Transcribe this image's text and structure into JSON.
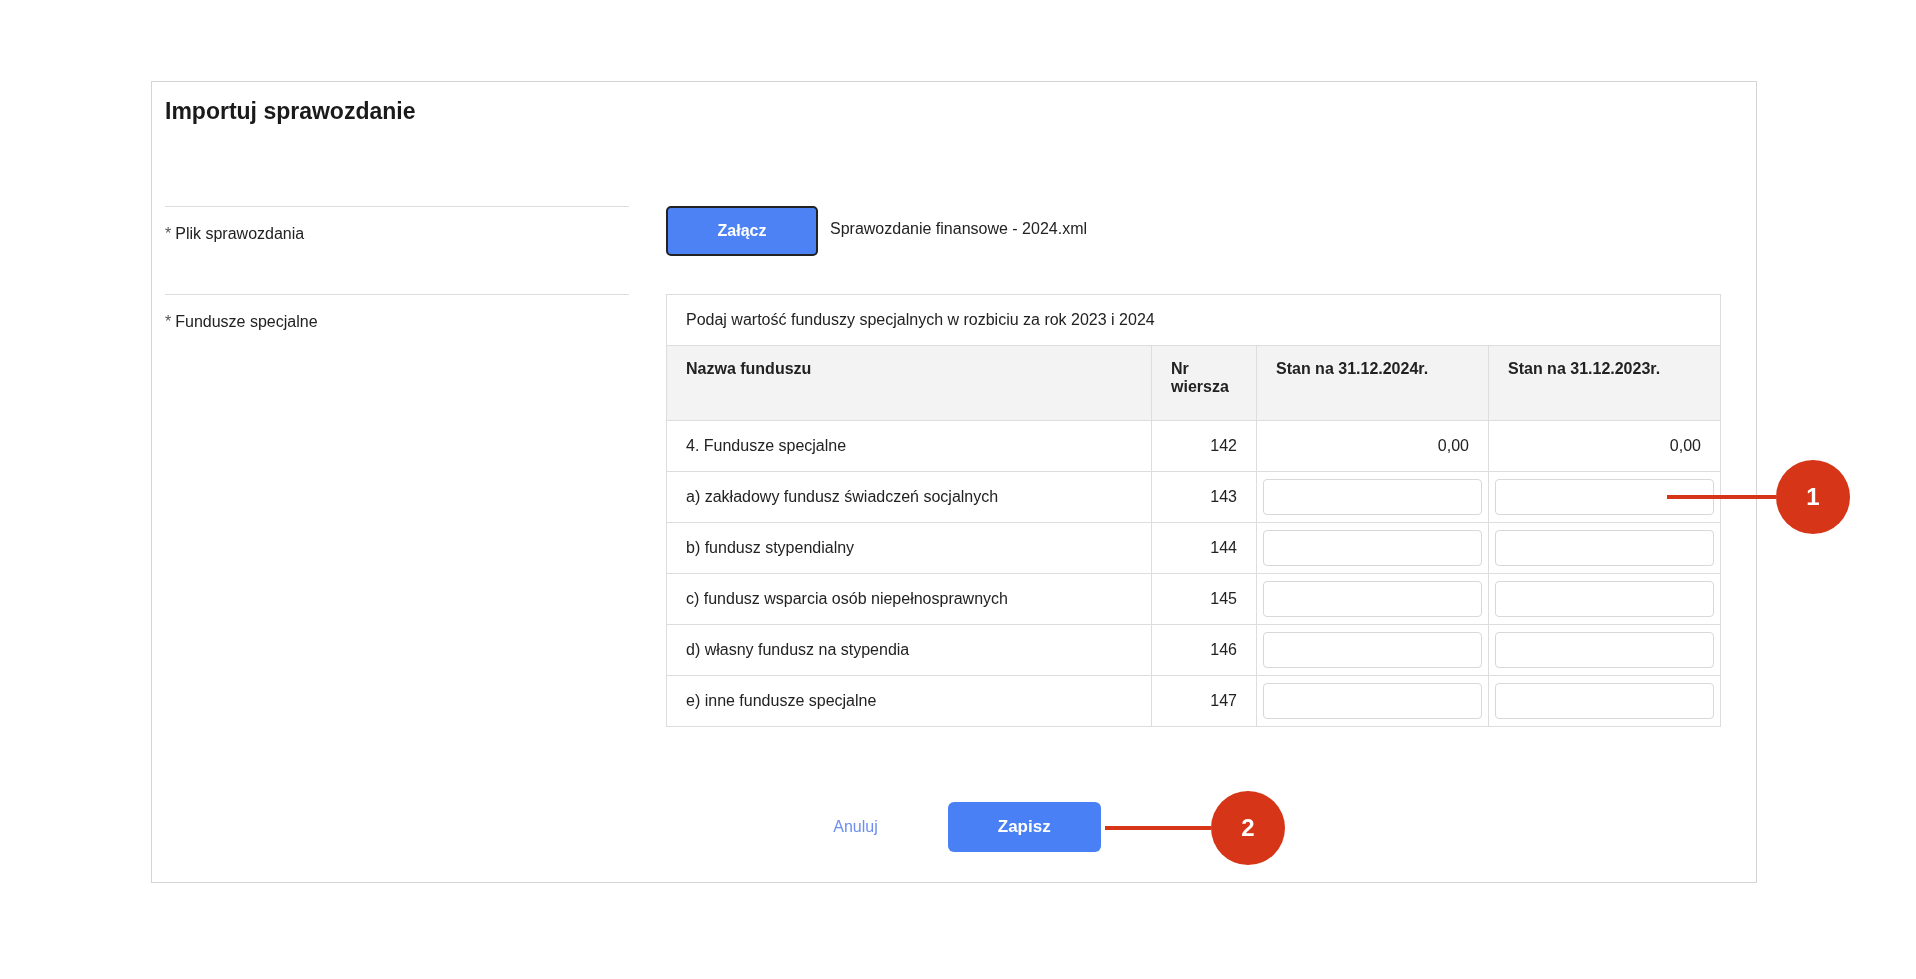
{
  "title": "Importuj sprawozdanie",
  "fields": [
    {
      "mark": "*",
      "label": "Plik sprawozdania"
    },
    {
      "mark": "*",
      "label": "Fundusze specjalne"
    }
  ],
  "attach": {
    "button": "Załącz",
    "file_name": "Sprawozdanie finansowe - 2024.xml"
  },
  "table": {
    "caption": "Podaj wartość funduszy specjalnych w rozbiciu za rok 2023 i 2024",
    "columns": [
      "Nazwa funduszu",
      "Nr wiersza",
      "Stan na 31.12.2024r.",
      "Stan na 31.12.2023r."
    ],
    "rows": [
      {
        "kind": "total",
        "name": "4. Fundusze specjalne",
        "nr": "142",
        "values": [
          "0,00",
          "0,00"
        ]
      },
      {
        "kind": "input",
        "name": "a) zakładowy fundusz świadczeń socjalnych",
        "nr": "143"
      },
      {
        "kind": "input",
        "name": "b) fundusz stypendialny",
        "nr": "144"
      },
      {
        "kind": "input",
        "name": "c) fundusz wsparcia osób niepełnosprawnych",
        "nr": "145"
      },
      {
        "kind": "input",
        "name": "d) własny fundusz na stypendia",
        "nr": "146"
      },
      {
        "kind": "input",
        "name": "e) inne fundusze specjalne",
        "nr": "147"
      }
    ]
  },
  "actions": {
    "cancel": "Anuluj",
    "save": "Zapisz"
  },
  "callouts": [
    {
      "label": "1"
    },
    {
      "label": "2"
    }
  ]
}
